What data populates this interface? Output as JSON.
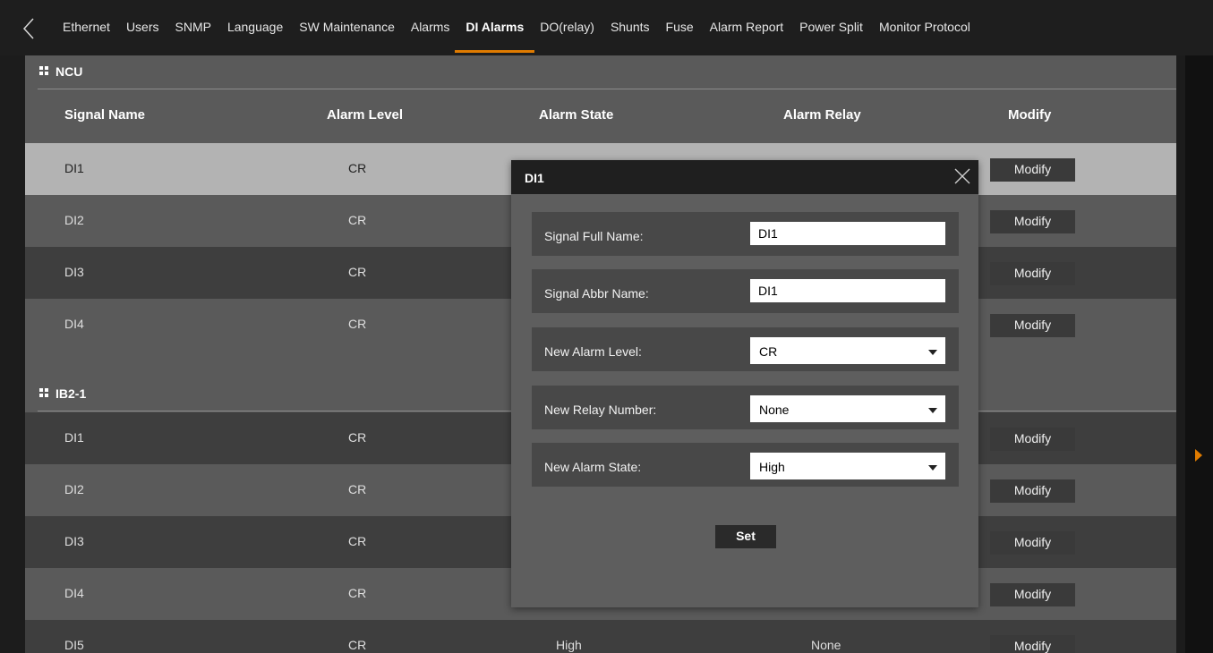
{
  "tabs": {
    "items": [
      "Ethernet",
      "Users",
      "SNMP",
      "Language",
      "SW Maintenance",
      "Alarms",
      "DI Alarms",
      "DO(relay)",
      "Shunts",
      "Fuse",
      "Alarm Report",
      "Power Split",
      "Monitor Protocol"
    ],
    "active": "DI Alarms"
  },
  "columns": {
    "signal_name": "Signal Name",
    "alarm_level": "Alarm Level",
    "alarm_state": "Alarm State",
    "alarm_relay": "Alarm Relay",
    "modify": "Modify"
  },
  "sections": [
    {
      "title": "NCU",
      "rows": [
        {
          "name": "DI1",
          "level": "CR",
          "state": "",
          "relay": "",
          "modify": "Modify"
        },
        {
          "name": "DI2",
          "level": "CR",
          "state": "",
          "relay": "",
          "modify": "Modify"
        },
        {
          "name": "DI3",
          "level": "CR",
          "state": "",
          "relay": "",
          "modify": "Modify"
        },
        {
          "name": "DI4",
          "level": "CR",
          "state": "",
          "relay": "",
          "modify": "Modify"
        }
      ]
    },
    {
      "title": "IB2-1",
      "rows": [
        {
          "name": "DI1",
          "level": "CR",
          "state": "",
          "relay": "",
          "modify": "Modify"
        },
        {
          "name": "DI2",
          "level": "CR",
          "state": "",
          "relay": "",
          "modify": "Modify"
        },
        {
          "name": "DI3",
          "level": "CR",
          "state": "",
          "relay": "",
          "modify": "Modify"
        },
        {
          "name": "DI4",
          "level": "CR",
          "state": "",
          "relay": "",
          "modify": "Modify"
        },
        {
          "name": "DI5",
          "level": "CR",
          "state": "High",
          "relay": "None",
          "modify": "Modify"
        }
      ]
    }
  ],
  "dialog": {
    "title": "DI1",
    "signal_full_name_label": "Signal Full Name:",
    "signal_full_name_value": "DI1",
    "signal_abbr_name_label": "Signal Abbr Name:",
    "signal_abbr_name_value": "DI1",
    "new_alarm_level_label": "New Alarm Level:",
    "new_alarm_level_value": "CR",
    "new_relay_number_label": "New Relay Number:",
    "new_relay_number_value": "None",
    "new_alarm_state_label": "New Alarm State:",
    "new_alarm_state_value": "High",
    "set_label": "Set"
  },
  "colors": {
    "accent": "#e07b00",
    "panel": "#5a5a5a",
    "row_dark": "#3e3e3e",
    "row_selected": "#b3b3b3",
    "tabbar": "#1e1e1e"
  }
}
